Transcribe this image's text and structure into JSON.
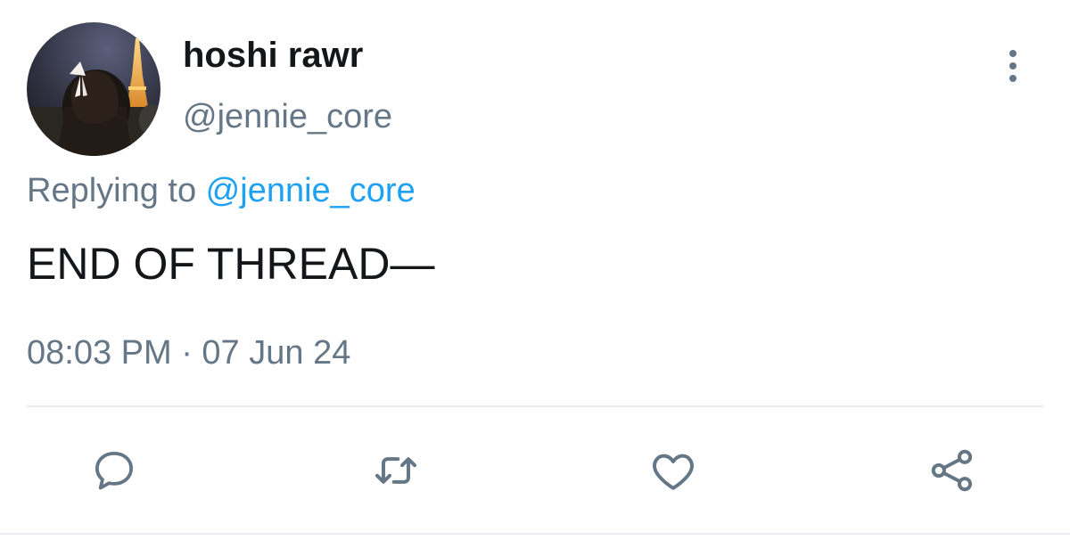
{
  "author": {
    "display_name": "hoshi rawr",
    "handle": "@jennie_core"
  },
  "reply": {
    "prefix": "Replying to ",
    "mention": "@jennie_core"
  },
  "tweet": {
    "text": "END OF THREAD—",
    "timestamp": "08:03 PM · 07 Jun 24"
  },
  "icons": {
    "more": "more-vertical-icon",
    "reply": "reply-icon",
    "retweet": "retweet-icon",
    "like": "like-icon",
    "share": "share-icon"
  },
  "colors": {
    "text_primary": "#14171a",
    "text_secondary": "#657786",
    "link": "#1da1f2",
    "divider": "#e6ecf0"
  }
}
